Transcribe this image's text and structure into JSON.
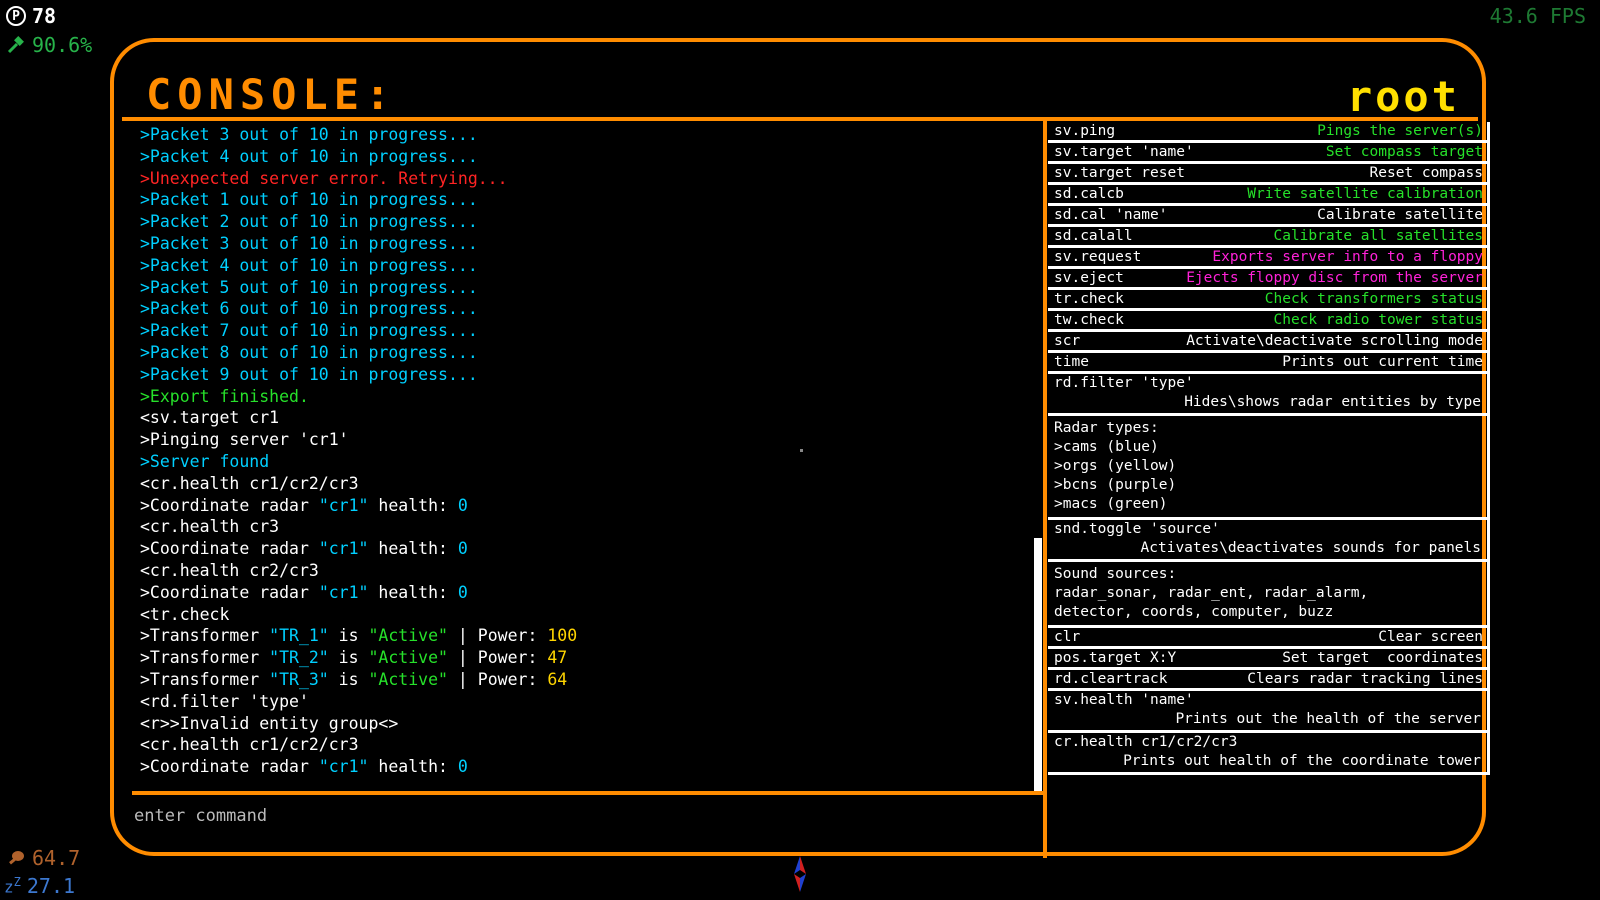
{
  "hud": {
    "points": "78",
    "points_icon": "p-coin-icon",
    "progress": "90.6%",
    "progress_icon": "hammer-icon",
    "fps": "43.6 FPS",
    "food": "64.7",
    "food_icon": "drumstick-icon",
    "sleep": "27.1",
    "sleep_icon": "zz-sleep-icon"
  },
  "console": {
    "title": "CONSOLE:",
    "user": "root",
    "input_placeholder": "enter command"
  },
  "log": [
    {
      "text": ">Packet 3 out of 10 in progress...",
      "color": "cyan"
    },
    {
      "text": ">Packet 4 out of 10 in progress...",
      "color": "cyan"
    },
    {
      "text": ">Unexpected server error. Retrying...",
      "color": "red"
    },
    {
      "text": ">Packet 1 out of 10 in progress...",
      "color": "cyan"
    },
    {
      "text": ">Packet 2 out of 10 in progress...",
      "color": "cyan"
    },
    {
      "text": ">Packet 3 out of 10 in progress...",
      "color": "cyan"
    },
    {
      "text": ">Packet 4 out of 10 in progress...",
      "color": "cyan"
    },
    {
      "text": ">Packet 5 out of 10 in progress...",
      "color": "cyan"
    },
    {
      "text": ">Packet 6 out of 10 in progress...",
      "color": "cyan"
    },
    {
      "text": ">Packet 7 out of 10 in progress...",
      "color": "cyan"
    },
    {
      "text": ">Packet 8 out of 10 in progress...",
      "color": "cyan"
    },
    {
      "text": ">Packet 9 out of 10 in progress...",
      "color": "cyan"
    },
    {
      "text": ">Export finished.",
      "color": "green"
    },
    {
      "text": "<sv.target cr1",
      "color": "white"
    },
    {
      "text": ">Pinging server 'cr1'",
      "color": "white"
    },
    {
      "text": ">Server found",
      "color": "cyan"
    },
    {
      "text": "<cr.health cr1/cr2/cr3",
      "color": "white"
    },
    {
      "segments": [
        {
          "t": ">Coordinate radar ",
          "c": "white"
        },
        {
          "t": "\"cr1\"",
          "c": "cyan"
        },
        {
          "t": " health: ",
          "c": "white"
        },
        {
          "t": "0",
          "c": "cyan"
        }
      ]
    },
    {
      "text": "<cr.health cr3",
      "color": "white"
    },
    {
      "segments": [
        {
          "t": ">Coordinate radar ",
          "c": "white"
        },
        {
          "t": "\"cr1\"",
          "c": "cyan"
        },
        {
          "t": " health: ",
          "c": "white"
        },
        {
          "t": "0",
          "c": "cyan"
        }
      ]
    },
    {
      "text": "<cr.health cr2/cr3",
      "color": "white"
    },
    {
      "segments": [
        {
          "t": ">Coordinate radar ",
          "c": "white"
        },
        {
          "t": "\"cr1\"",
          "c": "cyan"
        },
        {
          "t": " health: ",
          "c": "white"
        },
        {
          "t": "0",
          "c": "cyan"
        }
      ]
    },
    {
      "text": "<tr.check",
      "color": "white"
    },
    {
      "segments": [
        {
          "t": ">Transformer ",
          "c": "white"
        },
        {
          "t": "\"TR_1\"",
          "c": "cyan"
        },
        {
          "t": " is ",
          "c": "white"
        },
        {
          "t": "\"Active\"",
          "c": "green"
        },
        {
          "t": " | Power: ",
          "c": "white"
        },
        {
          "t": "100",
          "c": "yellow"
        }
      ]
    },
    {
      "segments": [
        {
          "t": ">Transformer ",
          "c": "white"
        },
        {
          "t": "\"TR_2\"",
          "c": "cyan"
        },
        {
          "t": " is ",
          "c": "white"
        },
        {
          "t": "\"Active\"",
          "c": "green"
        },
        {
          "t": " | Power: ",
          "c": "white"
        },
        {
          "t": "47",
          "c": "yellow"
        }
      ]
    },
    {
      "segments": [
        {
          "t": ">Transformer ",
          "c": "white"
        },
        {
          "t": "\"TR_3\"",
          "c": "cyan"
        },
        {
          "t": " is ",
          "c": "white"
        },
        {
          "t": "\"Active\"",
          "c": "green"
        },
        {
          "t": " | Power: ",
          "c": "white"
        },
        {
          "t": "64",
          "c": "yellow"
        }
      ]
    },
    {
      "text": "<rd.filter 'type'",
      "color": "white"
    },
    {
      "text": "<r>>Invalid entity group<>",
      "color": "white"
    },
    {
      "text": "<cr.health cr1/cr2/cr3",
      "color": "white"
    },
    {
      "segments": [
        {
          "t": ">Coordinate radar ",
          "c": "white"
        },
        {
          "t": "\"cr1\"",
          "c": "cyan"
        },
        {
          "t": " health: ",
          "c": "white"
        },
        {
          "t": "0",
          "c": "cyan"
        }
      ]
    }
  ],
  "help": [
    {
      "cmd": "sv.ping",
      "desc": "Pings the server(s)",
      "desc_color": "green"
    },
    {
      "cmd": "sv.target 'name'",
      "desc": "Set compass target",
      "desc_color": "green"
    },
    {
      "cmd": "sv.target reset",
      "desc": "Reset compass",
      "desc_color": "white"
    },
    {
      "cmd": "sd.calcb",
      "desc": "Write satellite calibration",
      "desc_color": "green"
    },
    {
      "cmd": "sd.cal 'name'",
      "desc": "Calibrate satellite",
      "desc_color": "white"
    },
    {
      "cmd": "sd.calall",
      "desc": "Calibrate all satellites",
      "desc_color": "green"
    },
    {
      "cmd": "sv.request",
      "desc": "Exports server info to a floppy",
      "desc_color": "magenta"
    },
    {
      "cmd": "sv.eject",
      "desc": "Ejects floppy disc from the server",
      "desc_color": "magenta"
    },
    {
      "cmd": "tr.check",
      "desc": "Check transformers status",
      "desc_color": "green"
    },
    {
      "cmd": "tw.check",
      "desc": "Check radio tower status",
      "desc_color": "green"
    },
    {
      "cmd": "scr",
      "desc": "Activate\\deactivate scrolling mode",
      "desc_color": "white"
    },
    {
      "cmd": "time",
      "desc": "Prints out current time",
      "desc_color": "white"
    },
    {
      "cmd": "rd.filter 'type'",
      "sub": "Hides\\shows radar entities by type"
    },
    {
      "text": "Radar types:\n>cams (blue)\n>orgs (yellow)\n>bcns (purple)\n>macs (green)"
    },
    {
      "cmd": "snd.toggle 'source'",
      "sub": "Activates\\deactivates sounds for panels"
    },
    {
      "text": "Sound sources:\nradar_sonar, radar_ent, radar_alarm,\ndetector, coords, computer, buzz"
    },
    {
      "cmd": "clr",
      "desc": "Clear screen",
      "desc_color": "white"
    },
    {
      "cmd": "pos.target X:Y",
      "desc": "Set target  coordinates",
      "desc_color": "white"
    },
    {
      "cmd": "rd.cleartrack",
      "desc": "Clears radar tracking lines",
      "desc_color": "white"
    },
    {
      "cmd": "sv.health 'name'",
      "sub": "Prints out the health of the server"
    },
    {
      "cmd": "cr.health cr1/cr2/cr3",
      "sub": "Prints out health of the coordinate tower"
    }
  ],
  "colors": {
    "frame": "#ff8c00",
    "title": "#ff8c00",
    "user": "#ffe000",
    "cyan": "#00d0ff",
    "red": "#ff2424",
    "green": "#26e02a",
    "yellow": "#ffd500",
    "magenta": "#ff22d8"
  }
}
